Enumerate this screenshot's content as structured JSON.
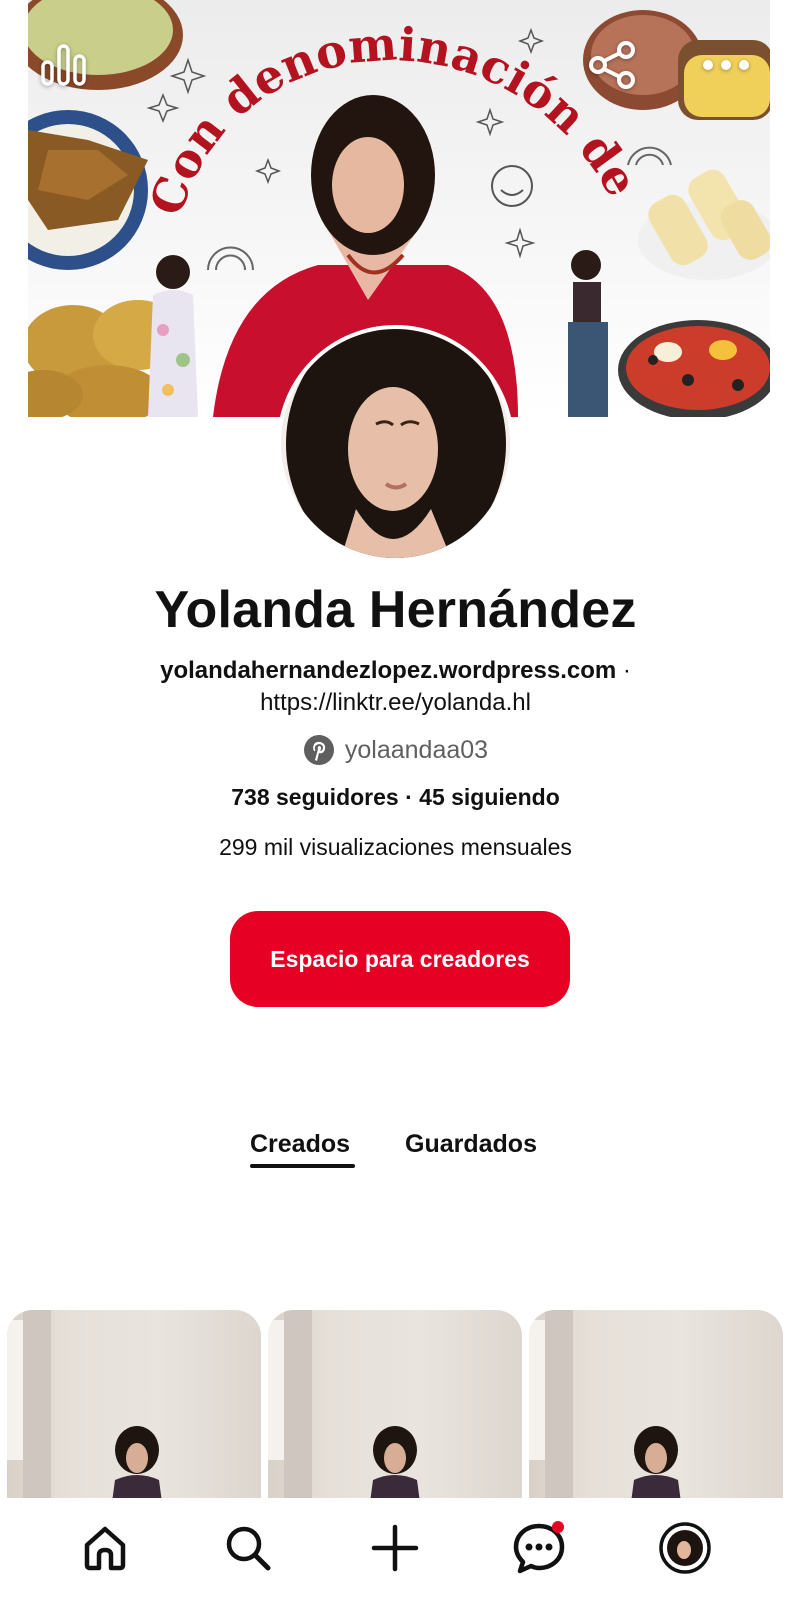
{
  "cover": {
    "banner_text": "Con denominación de origen"
  },
  "profile": {
    "name": "Yolanda Hernández",
    "website": "yolandahernandezlopez.wordpress.com",
    "separator": " ·",
    "link": "https://linktr.ee/yolanda.hl",
    "handle": "yolaandaa03",
    "followers": "738 seguidores",
    "stats_separator": " · ",
    "following": "45 siguiendo",
    "monthly_views": "299 mil visualizaciones mensuales"
  },
  "actions": {
    "creator_hub_label": "Espacio para creadores"
  },
  "tabs": [
    {
      "label": "Creados",
      "active": true
    },
    {
      "label": "Guardados",
      "active": false
    }
  ],
  "icons": {
    "analytics": "bar-chart-icon",
    "share": "share-icon",
    "more": "more-horizontal-icon",
    "pinterest": "pinterest-logo-icon",
    "home": "home-icon",
    "search": "search-icon",
    "create": "plus-icon",
    "messages": "chat-bubble-icon",
    "profile": "profile-avatar-icon"
  },
  "colors": {
    "accent": "#e60023",
    "banner_text": "#b3121f",
    "text": "#111111",
    "muted": "#5f5f5f"
  },
  "notifications": {
    "messages_dot": true
  }
}
